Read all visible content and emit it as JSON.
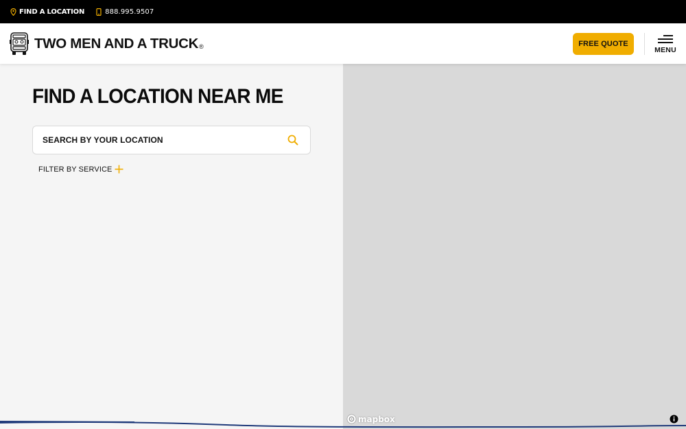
{
  "topbar": {
    "location_label": "FIND A LOCATION",
    "phone_label": "888.995.9507"
  },
  "header": {
    "brand": "TWO MEN AND A TRUCK",
    "registered_mark": "®",
    "quote_label": "FREE QUOTE",
    "menu_label": "MENU"
  },
  "main": {
    "title": "FIND A LOCATION NEAR ME",
    "search_placeholder": "SEARCH BY YOUR LOCATION",
    "filter_label": "FILTER BY SERVICE"
  },
  "map": {
    "attribution_logo": "mapbox"
  },
  "colors": {
    "accent": "#f0ad00",
    "topbar": "#000000",
    "panel": "#f5f5f5",
    "map": "#d9d9d9",
    "wave": "#1f3a7a"
  }
}
